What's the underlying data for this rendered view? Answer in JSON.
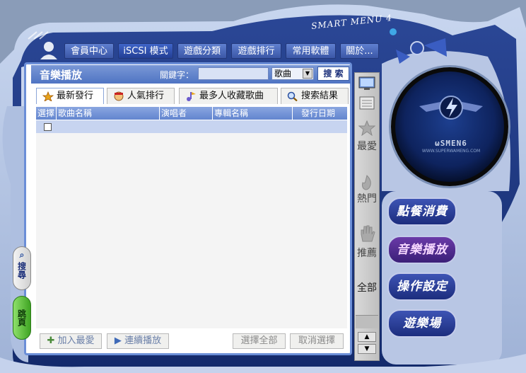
{
  "brand": "SMART MENU 4",
  "nav": {
    "items": [
      "會員中心",
      "iSCSI 模式",
      "遊戲分類",
      "遊戲排行",
      "常用軟體",
      "關於..."
    ]
  },
  "panel": {
    "title": "音樂播放",
    "keyword_label": "關鍵字：",
    "keyword_value": "",
    "type_select": "歌曲",
    "search_label": "搜 索"
  },
  "tabs": [
    "最新發行",
    "人氣排行",
    "最多人收藏歌曲",
    "搜索結果"
  ],
  "table": {
    "headers": [
      "選擇",
      "歌曲名稱",
      "演唱者",
      "專輯名稱",
      "發行日期"
    ]
  },
  "bottom": {
    "add_fav": "加入最愛",
    "continuous_play": "連續播放",
    "select_all": "選擇全部",
    "cancel_select": "取消選擇"
  },
  "sidebar": {
    "items": [
      "最愛",
      "熱門",
      "推薦",
      "全部"
    ]
  },
  "orb": {
    "logo_text": "ωSMEN6",
    "sub_text": "WWW.SUPERWAMENG.COM"
  },
  "menu": {
    "items": [
      "點餐消費",
      "音樂播放",
      "操作設定",
      "遊樂場"
    ]
  },
  "left_tabs": {
    "search": "搜尋",
    "jump": "跳頁"
  },
  "colors": {
    "accent": "#4f74c3",
    "header": "#6285cf",
    "frame": "#1e3575",
    "active_menu": "#6a3aa8"
  }
}
